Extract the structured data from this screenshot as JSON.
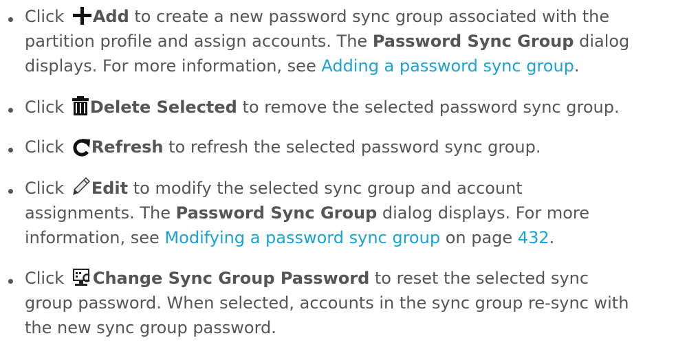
{
  "items": [
    {
      "icon": "plus-icon",
      "click": "Click",
      "action": "Add",
      "rest1": " to create a new password sync group associated with the",
      "line2_pre": "partition profile and assign accounts. The ",
      "line2_bold": "Password Sync Group",
      "line2_post": " dialog",
      "line3_pre": "displays. For more information, see ",
      "link": "Adding a password sync group",
      "line3_post": "."
    },
    {
      "icon": "trash-icon",
      "click": "Click",
      "action": "Delete Selected",
      "rest1": " to remove the selected password sync group."
    },
    {
      "icon": "refresh-icon",
      "click": "Click",
      "action": "Refresh",
      "rest1": " to refresh the selected password sync group."
    },
    {
      "icon": "pencil-icon",
      "click": "Click",
      "action": "Edit",
      "rest1": " to modify the selected sync group and account",
      "line2_pre": "assignments. The ",
      "line2_bold": "Password Sync Group",
      "line2_post": " dialog displays. For more",
      "line3_pre": "information, see ",
      "link": "Modifying a password sync group",
      "line3_mid": " on page ",
      "page_link": "432",
      "line3_post": "."
    },
    {
      "icon": "change-password-icon",
      "click": "Click",
      "action": "Change Sync Group Password",
      "rest1": " to reset the selected sync",
      "line2": "group password. When selected, accounts in the sync group re-sync with",
      "line3": "the new sync group password."
    }
  ],
  "colors": {
    "text": "#555555",
    "link": "#1aa3d4"
  }
}
